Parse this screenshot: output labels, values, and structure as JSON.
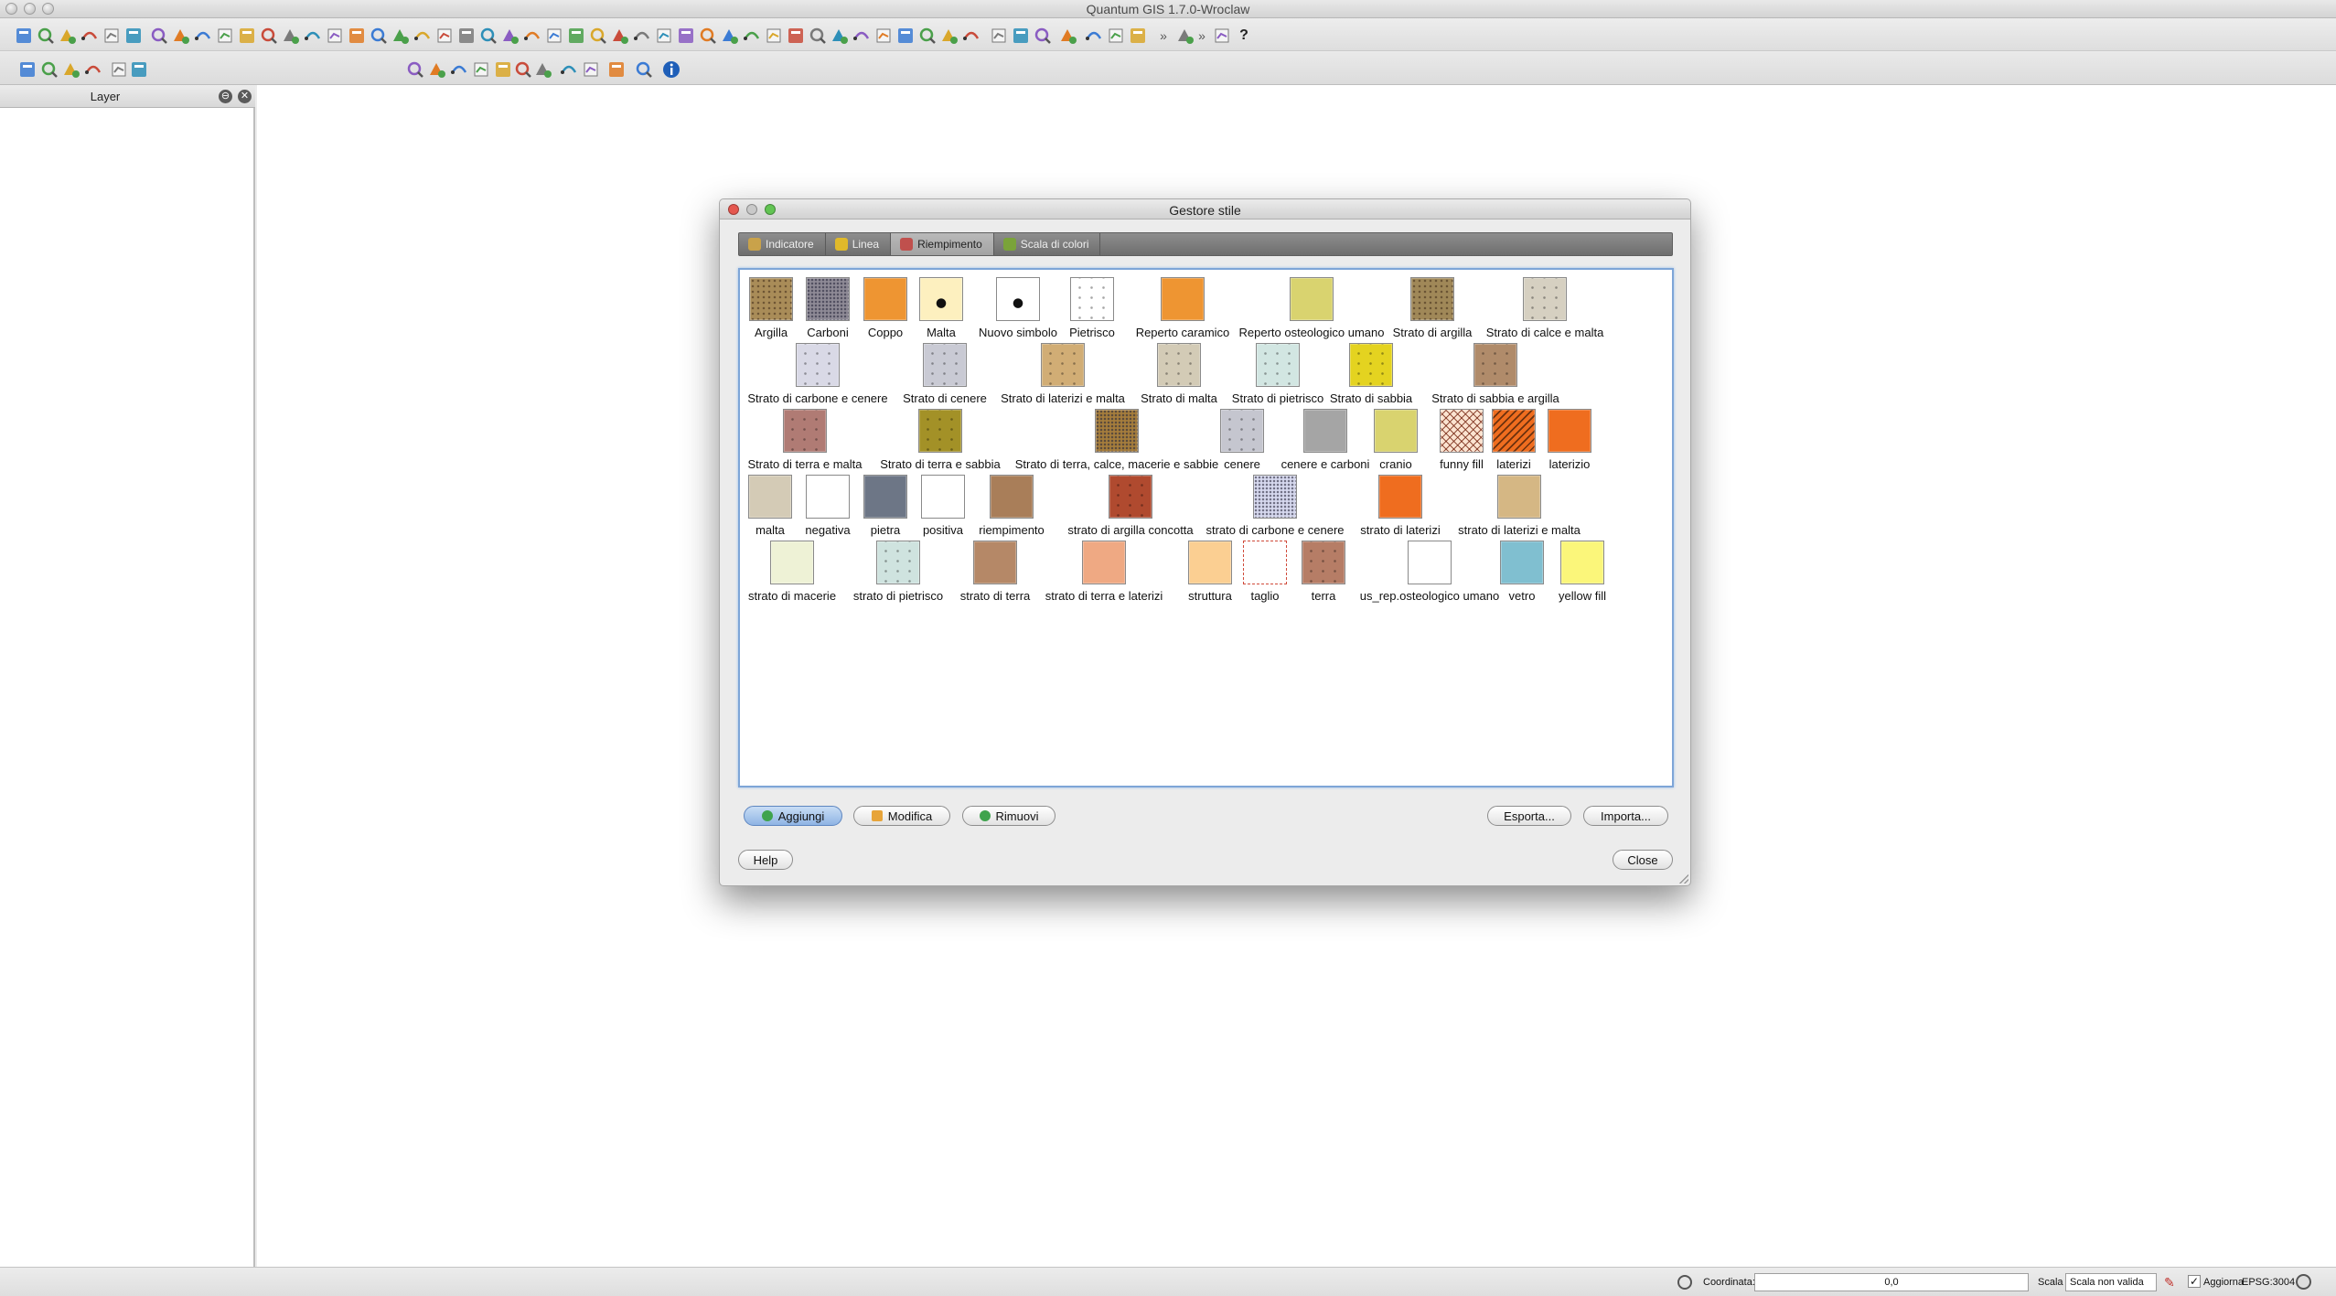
{
  "window": {
    "title": "Quantum GIS 1.7.0-Wroclaw"
  },
  "layer_panel": {
    "title": "Layer"
  },
  "status": {
    "coord_label": "Coordinata:",
    "coord_value": "0,0",
    "scale_label": "Scala",
    "scale_value": "Scala non valida",
    "update_label": "Aggiorna",
    "update_checked": true,
    "crs": "EPSG:3004"
  },
  "dialog": {
    "title": "Gestore stile",
    "tabs": [
      {
        "label": "Indicatore",
        "icon": "marker-icon",
        "color": "#c9a24a"
      },
      {
        "label": "Linea",
        "icon": "line-icon",
        "color": "#e0b92a"
      },
      {
        "label": "Riempimento",
        "icon": "fill-icon",
        "color": "#c0504d"
      },
      {
        "label": "Scala di colori",
        "icon": "color-ramp-icon",
        "color": "#7aa33a"
      }
    ],
    "active_tab": 2,
    "symbols": [
      {
        "name": "Argilla",
        "color": "#a98c58",
        "pattern": "dots"
      },
      {
        "name": "Carboni",
        "color": "#8e8a96",
        "pattern": "grid"
      },
      {
        "name": "Coppo",
        "color": "#ee9532",
        "pattern": "none"
      },
      {
        "name": "Malta",
        "color": "#fdf0bf",
        "pattern": "bigdot"
      },
      {
        "name": "Nuovo simbolo",
        "color": "#ffffff",
        "pattern": "bigdot"
      },
      {
        "name": "Pietrisco",
        "color": "#ffffff",
        "pattern": "specks"
      },
      {
        "name": "Reperto caramico",
        "color": "#ee9532",
        "pattern": "none"
      },
      {
        "name": "Reperto osteologico umano",
        "color": "#d9d36f",
        "pattern": "none"
      },
      {
        "name": "Strato di argilla",
        "color": "#a08858",
        "pattern": "dots"
      },
      {
        "name": "Strato di calce e malta",
        "color": "#d6d0c1",
        "pattern": "specks"
      },
      {
        "name": "Strato di carbone e cenere",
        "color": "#d9d9e6",
        "pattern": "specks"
      },
      {
        "name": "Strato di cenere",
        "color": "#c9cad4",
        "pattern": "specks"
      },
      {
        "name": "Strato di laterizi e malta",
        "color": "#d1ad75",
        "pattern": "specks"
      },
      {
        "name": "Strato di malta",
        "color": "#d3cbb6",
        "pattern": "specks"
      },
      {
        "name": "Strato di pietrisco",
        "color": "#d2e6e2",
        "pattern": "specks"
      },
      {
        "name": "Strato di sabbia",
        "color": "#e4d320",
        "pattern": "specks"
      },
      {
        "name": "Strato di sabbia e argilla",
        "color": "#b08b6a",
        "pattern": "specks"
      },
      {
        "name": "Strato di terra e malta",
        "color": "#b07b74",
        "pattern": "specks"
      },
      {
        "name": "Strato di terra e sabbia",
        "color": "#a39127",
        "pattern": "specks"
      },
      {
        "name": "Strato di terra, calce, macerie e sabbie",
        "color": "#a57d3c",
        "pattern": "grid"
      },
      {
        "name": "cenere",
        "color": "#c5c6cf",
        "pattern": "specks"
      },
      {
        "name": "cenere e carboni",
        "color": "#a5a5a5",
        "pattern": "none"
      },
      {
        "name": "cranio",
        "color": "#d9d36f",
        "pattern": "none"
      },
      {
        "name": "funny fill",
        "color": "#fbe3d0",
        "pattern": "cross"
      },
      {
        "name": "laterizi",
        "color": "#ef6d1f",
        "pattern": "hatch"
      },
      {
        "name": "laterizio",
        "color": "#ef6d1f",
        "pattern": "none"
      },
      {
        "name": "malta",
        "color": "#d4cbb6",
        "pattern": "none"
      },
      {
        "name": "negativa",
        "color": "#ffffff",
        "pattern": "none"
      },
      {
        "name": "pietra",
        "color": "#6d7686",
        "pattern": "none"
      },
      {
        "name": "positiva",
        "color": "#ffffff",
        "pattern": "none"
      },
      {
        "name": "riempimento",
        "color": "#a97e59",
        "pattern": "none"
      },
      {
        "name": "strato di argilla concotta",
        "color": "#b04a2f",
        "pattern": "specks"
      },
      {
        "name": "strato di carbone e cenere",
        "color": "#d6d8ee",
        "pattern": "grid"
      },
      {
        "name": "strato di laterizi",
        "color": "#ef6d1f",
        "pattern": "none"
      },
      {
        "name": "strato di laterizi e malta",
        "color": "#d5b784",
        "pattern": "none"
      },
      {
        "name": "strato di macerie",
        "color": "#eef2d6",
        "pattern": "none"
      },
      {
        "name": "strato di pietrisco",
        "color": "#cfe3df",
        "pattern": "specks"
      },
      {
        "name": "strato di terra",
        "color": "#b58867",
        "pattern": "none"
      },
      {
        "name": "strato di terra e laterizi",
        "color": "#efa983",
        "pattern": "none"
      },
      {
        "name": "struttura",
        "color": "#fbcf92",
        "pattern": "none"
      },
      {
        "name": "taglio",
        "color": "#ffffff",
        "pattern": "dashed"
      },
      {
        "name": "terra",
        "color": "#b67d66",
        "pattern": "specks"
      },
      {
        "name": "us_rep.osteologico umano",
        "color": "#ffffff",
        "pattern": "none"
      },
      {
        "name": "vetro",
        "color": "#80bfd0",
        "pattern": "none"
      },
      {
        "name": "yellow fill",
        "color": "#fbf67a",
        "pattern": "none"
      }
    ],
    "buttons": {
      "add": "Aggiungi",
      "edit": "Modifica",
      "remove": "Rimuovi",
      "export": "Esporta...",
      "import": "Importa...",
      "help": "Help",
      "close": "Close"
    }
  },
  "toolbar_main": [
    "new-project-icon",
    "open-project-icon",
    "save-project-icon",
    "save-as-icon",
    "print-composer-icon",
    "print-icon",
    "add-vector-icon",
    "add-raster-icon",
    "add-postgis-icon",
    "add-spatialite-icon",
    "add-wms-icon",
    "new-shapefile-icon",
    "remove-layer-icon",
    "toggle-edit-icon",
    "save-edits-icon",
    "move-feature-icon",
    "node-tool-icon",
    "delete-selected-icon",
    "cut-icon",
    "copy-icon",
    "paste-icon",
    "undo-icon",
    "redo-icon",
    "add-ring-icon",
    "add-part-icon",
    "simplify-icon",
    "delete-ring-icon",
    "delete-part-icon",
    "reshape-icon",
    "split-icon",
    "merge-icon",
    "merge-attributes-icon",
    "rotate-icon",
    "pan-icon",
    "zoom-in-icon",
    "zoom-out-icon",
    "zoom-full-icon",
    "zoom-layer-icon",
    "zoom-selection-icon",
    "zoom-last-icon",
    "zoom-next-icon",
    "zoom-actual-icon",
    "refresh-icon",
    "map-tips-icon",
    "identify-icon",
    "select-icon",
    "attribute-table-icon",
    "measure-icon",
    "annotation-icon",
    "bookmark-icon",
    "new-bookmark-icon",
    "more-icon",
    "plugin-leaf-icon",
    "more-icon",
    "magnet-icon",
    "whats-this-icon"
  ],
  "toolbar_second": [
    "digitize-icon",
    "capture-point-icon",
    "capture-line-icon",
    "capture-polygon-icon",
    "raster-tools-icon",
    "histogram-icon",
    "plugin-a-icon",
    "plugin-b-icon",
    "plugin-c-icon",
    "plugin-d-icon",
    "plugin-e-icon",
    "plugin-f-icon",
    "plugin-g-icon",
    "globe-icon",
    "sync-icon",
    "camera-icon",
    "python-icon",
    "info-icon"
  ]
}
